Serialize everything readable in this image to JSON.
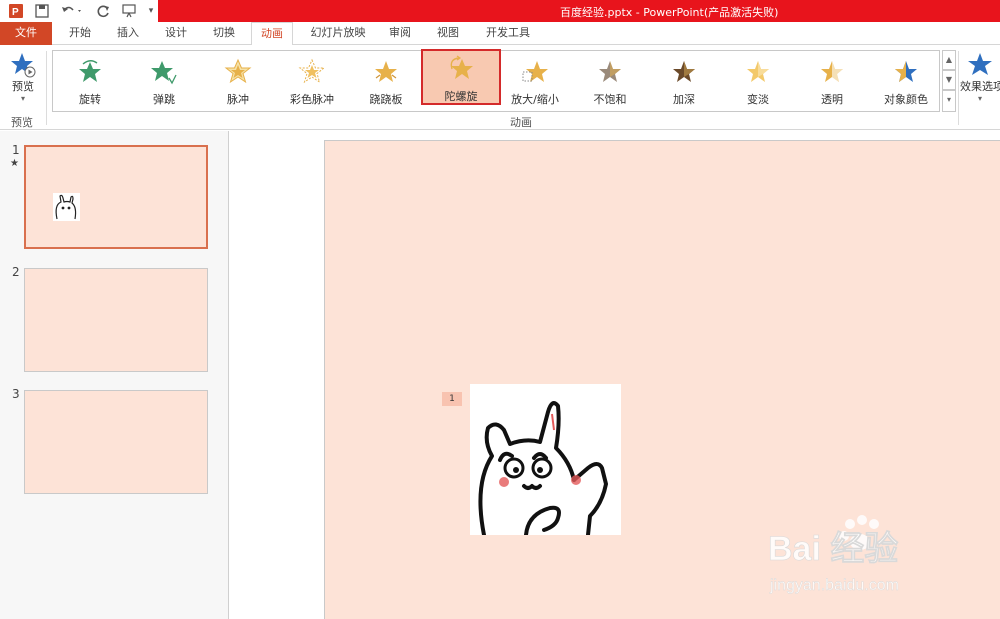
{
  "window": {
    "title": "百度经验.pptx - PowerPoint(产品激活失败)"
  },
  "quick_access": {
    "icons": [
      "powerpoint-logo-icon",
      "save-icon",
      "undo-icon",
      "redo-icon",
      "start-from-beginning-icon",
      "customize-icon"
    ]
  },
  "tabs": [
    {
      "label": "文件"
    },
    {
      "label": "开始"
    },
    {
      "label": "插入"
    },
    {
      "label": "设计"
    },
    {
      "label": "切换"
    },
    {
      "label": "动画"
    },
    {
      "label": "幻灯片放映"
    },
    {
      "label": "审阅"
    },
    {
      "label": "视图"
    },
    {
      "label": "开发工具"
    }
  ],
  "active_tab": "动画",
  "ribbon": {
    "preview_label": "预览",
    "preview_group": "预览",
    "animation_group": "动画",
    "effect_options_label": "效果选项",
    "animations": [
      {
        "label": "旋转",
        "color": "#3f9a6b"
      },
      {
        "label": "弹跳",
        "color": "#3f9a6b"
      },
      {
        "label": "脉冲",
        "color": "#e7b14a"
      },
      {
        "label": "彩色脉冲",
        "color": "#e7b14a"
      },
      {
        "label": "跷跷板",
        "color": "#e7b14a"
      },
      {
        "label": "陀螺旋",
        "color": "#e7b14a",
        "selected": true
      },
      {
        "label": "放大/缩小",
        "color": "#e7b14a"
      },
      {
        "label": "不饱和",
        "color": "#9a8a7a"
      },
      {
        "label": "加深",
        "color": "#6b4a2a"
      },
      {
        "label": "变淡",
        "color": "#f0c060"
      },
      {
        "label": "透明",
        "color": "#e7b14a"
      },
      {
        "label": "对象颜色",
        "color": "#2f6fbf"
      }
    ]
  },
  "slides": [
    {
      "number": "1",
      "has_animation": "★"
    },
    {
      "number": "2"
    },
    {
      "number": "3"
    }
  ],
  "editor": {
    "animation_tag": "1"
  },
  "watermark": {
    "brand": "Bai 经验",
    "url": "jingyan.baidu.com"
  },
  "colors": {
    "accent": "#d24726",
    "slide_bg": "#fde3d7",
    "title_bar": "#e8141c"
  }
}
